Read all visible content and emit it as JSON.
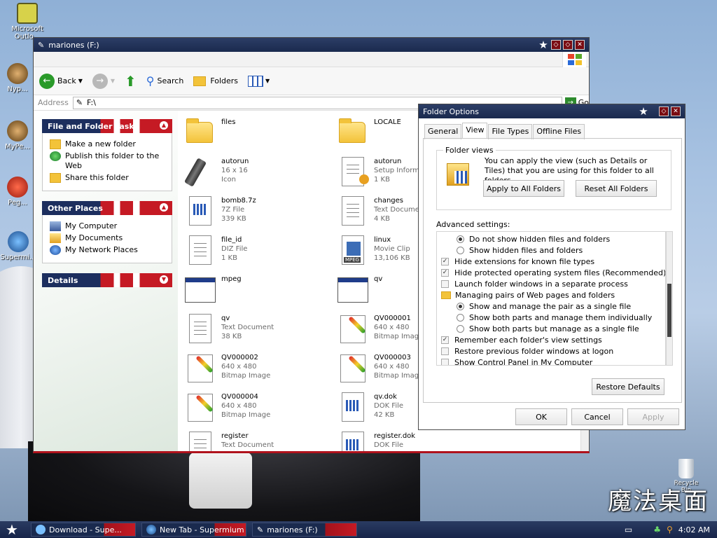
{
  "desktop": {
    "icons": [
      {
        "label": "Microsoft Outlo..."
      },
      {
        "label": "Nyp..."
      },
      {
        "label": "MyPe..."
      },
      {
        "label": "Peg..."
      },
      {
        "label": "Supermi..."
      }
    ],
    "recycle_label": "Recycle Bin",
    "logo_text": "魔法桌面"
  },
  "explorer": {
    "title": "mariones (F:)",
    "toolbar": {
      "back": "Back",
      "search": "Search",
      "folders": "Folders"
    },
    "address": {
      "label": "Address",
      "value": "F:\\",
      "go": "Go"
    },
    "tasks": {
      "header": "File and Folder Tasks",
      "items": [
        "Make a new folder",
        "Publish this folder to the Web",
        "Share this folder"
      ]
    },
    "other_places": {
      "header": "Other Places",
      "items": [
        "My Computer",
        "My Documents",
        "My Network Places"
      ]
    },
    "details": {
      "header": "Details"
    },
    "files": [
      {
        "name": "files",
        "l1": "",
        "l2": "",
        "icon": "folder"
      },
      {
        "name": "LOCALE",
        "l1": "",
        "l2": "",
        "icon": "folder"
      },
      {
        "name": "autorun",
        "l1": "16 x 16",
        "l2": "Icon",
        "icon": "usb"
      },
      {
        "name": "autorun",
        "l1": "Setup Inform...",
        "l2": "1 KB",
        "icon": "setup"
      },
      {
        "name": "bomb8.7z",
        "l1": "7Z File",
        "l2": "339 KB",
        "icon": "grid-doc"
      },
      {
        "name": "changes",
        "l1": "Text Docume...",
        "l2": "4 KB",
        "icon": "text-doc"
      },
      {
        "name": "file_id",
        "l1": "DIZ File",
        "l2": "1 KB",
        "icon": "text-doc"
      },
      {
        "name": "linux",
        "l1": "Movie Clip",
        "l2": "13,106 KB",
        "icon": "mpeg"
      },
      {
        "name": "mpeg",
        "l1": "",
        "l2": "",
        "icon": "window"
      },
      {
        "name": "qv",
        "l1": "",
        "l2": "",
        "icon": "window"
      },
      {
        "name": "qv",
        "l1": "Text Document",
        "l2": "38 KB",
        "icon": "text-doc"
      },
      {
        "name": "QV000001",
        "l1": "640 x 480",
        "l2": "Bitmap Image",
        "icon": "bitmap"
      },
      {
        "name": "QV000002",
        "l1": "640 x 480",
        "l2": "Bitmap Image",
        "icon": "bitmap"
      },
      {
        "name": "QV000003",
        "l1": "640 x 480",
        "l2": "Bitmap Image",
        "icon": "bitmap"
      },
      {
        "name": "QV000004",
        "l1": "640 x 480",
        "l2": "Bitmap Image",
        "icon": "bitmap"
      },
      {
        "name": "qv.dok",
        "l1": "DOK File",
        "l2": "42 KB",
        "icon": "grid-doc"
      },
      {
        "name": "register",
        "l1": "Text Document",
        "l2": "",
        "icon": "text-doc"
      },
      {
        "name": "register.dok",
        "l1": "DOK File",
        "l2": "",
        "icon": "grid-doc"
      }
    ]
  },
  "folder_options": {
    "title": "Folder Options",
    "tabs": [
      "General",
      "View",
      "File Types",
      "Offline Files"
    ],
    "active_tab": "View",
    "folder_views": {
      "label": "Folder views",
      "description": "You can apply the view (such as Details or Tiles) that you are using for this folder to all folders.",
      "apply_all": "Apply to All Folders",
      "reset_all": "Reset All Folders"
    },
    "advanced_label": "Advanced settings:",
    "settings": [
      {
        "type": "radio",
        "checked": true,
        "text": "Do not show hidden files and folders"
      },
      {
        "type": "radio",
        "checked": false,
        "text": "Show hidden files and folders"
      },
      {
        "type": "check",
        "checked": true,
        "text": "Hide extensions for known file types"
      },
      {
        "type": "check",
        "checked": true,
        "text": "Hide protected operating system files (Recommended)"
      },
      {
        "type": "check",
        "checked": false,
        "text": "Launch folder windows in a separate process"
      },
      {
        "type": "folder",
        "checked": false,
        "text": "Managing pairs of Web pages and folders"
      },
      {
        "type": "radio",
        "checked": true,
        "text": "Show and manage the pair as a single file"
      },
      {
        "type": "radio",
        "checked": false,
        "text": "Show both parts and manage them individually"
      },
      {
        "type": "radio",
        "checked": false,
        "text": "Show both parts but manage as a single file"
      },
      {
        "type": "check",
        "checked": true,
        "text": "Remember each folder's view settings"
      },
      {
        "type": "check",
        "checked": false,
        "text": "Restore previous folder windows at logon"
      },
      {
        "type": "check",
        "checked": false,
        "text": "Show Control Panel in My Computer"
      }
    ],
    "restore_defaults": "Restore Defaults",
    "ok": "OK",
    "cancel": "Cancel",
    "apply": "Apply"
  },
  "taskbar": {
    "items": [
      "Download - Supe...",
      "New Tab - Supermium",
      "mariones (F:)"
    ],
    "clock": "4:02 AM"
  },
  "colors": {
    "titlebar": "#1a2a4e",
    "flag_red": "#c51a24",
    "folder_yellow": "#f3c33a"
  }
}
